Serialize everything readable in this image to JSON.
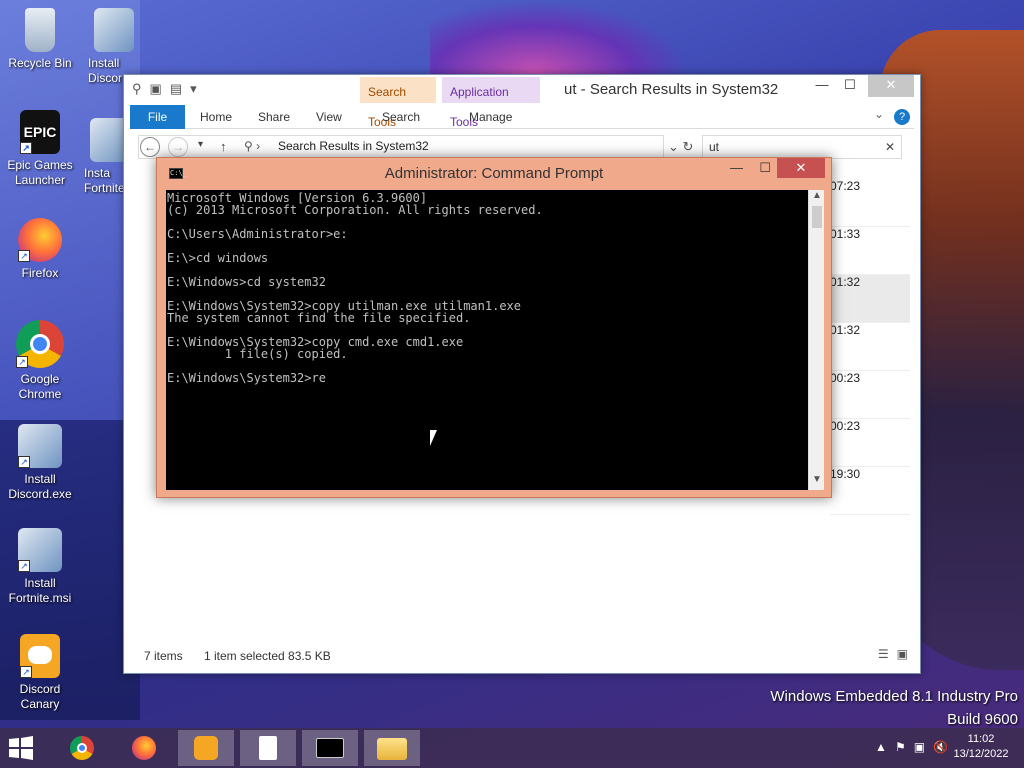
{
  "desktop": {
    "icons": [
      {
        "label": "Recycle Bin",
        "icon": "recycle-bin-icon"
      },
      {
        "label": "Install Discord",
        "icon": "installer-icon"
      },
      {
        "label": "Epic Games Launcher",
        "icon": "epic-games-icon"
      },
      {
        "label": "Install Fortnite",
        "icon": "installer-icon"
      },
      {
        "label": "Firefox",
        "icon": "firefox-icon"
      },
      {
        "label": "Google Chrome",
        "icon": "chrome-icon"
      },
      {
        "label": "Install Discord.exe",
        "icon": "installer-icon"
      },
      {
        "label": "Install Fortnite.msi",
        "icon": "installer-icon"
      },
      {
        "label": "Discord Canary",
        "icon": "discord-icon"
      }
    ],
    "partial_labels": [
      "Install",
      "Discor",
      "Insta",
      "Fortnite"
    ]
  },
  "explorer": {
    "title": "ut - Search Results in System32",
    "context_tabs": {
      "search_tools": "Search Tools",
      "application_tools": "Application Tools"
    },
    "ribbon_tabs": {
      "file": "File",
      "home": "Home",
      "share": "Share",
      "view": "View",
      "search": "Search",
      "manage": "Manage"
    },
    "address": "Search Results in System32",
    "search_value": "ut",
    "times": [
      "07:23",
      "01:33",
      "01:32",
      "01:32",
      "00:23",
      "00:23",
      "19:30"
    ],
    "status_items": "7 items",
    "status_selected": "1 item selected  83.5 KB",
    "help": "?"
  },
  "cmd": {
    "title": "Administrator: Command Prompt",
    "icon_text": "C:\\_",
    "lines": [
      "Microsoft Windows [Version 6.3.9600]",
      "(c) 2013 Microsoft Corporation. All rights reserved.",
      "",
      "C:\\Users\\Administrator>e:",
      "",
      "E:\\>cd windows",
      "",
      "E:\\Windows>cd system32",
      "",
      "E:\\Windows\\System32>copy utilman.exe utilman1.exe",
      "The system cannot find the file specified.",
      "",
      "E:\\Windows\\System32>copy cmd.exe cmd1.exe",
      "        1 file(s) copied.",
      "",
      "E:\\Windows\\System32>re"
    ]
  },
  "watermark": {
    "line1": "Windows Embedded 8.1 Industry Pro",
    "line2": "Build 9600"
  },
  "taskbar": {
    "items": [
      "start-icon",
      "chrome-icon",
      "firefox-icon",
      "discord-icon",
      "file-icon",
      "cmd-icon",
      "explorer-icon"
    ],
    "clock_time": "11:02",
    "clock_date": "13/12/2022"
  }
}
